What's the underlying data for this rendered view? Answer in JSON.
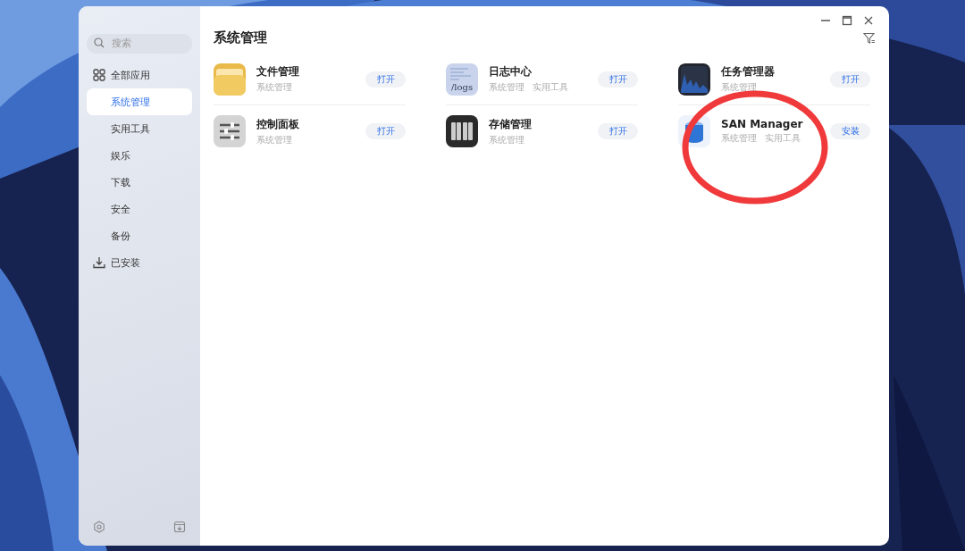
{
  "sidebar": {
    "search": {
      "placeholder": "搜索"
    },
    "items": [
      {
        "label": "全部应用",
        "kind": "group",
        "selected": false
      },
      {
        "label": "系统管理",
        "kind": "sub",
        "selected": true
      },
      {
        "label": "实用工具",
        "kind": "sub",
        "selected": false
      },
      {
        "label": "娱乐",
        "kind": "sub",
        "selected": false
      },
      {
        "label": "下载",
        "kind": "sub",
        "selected": false
      },
      {
        "label": "安全",
        "kind": "sub",
        "selected": false
      },
      {
        "label": "备份",
        "kind": "sub",
        "selected": false
      },
      {
        "label": "已安装",
        "kind": "group",
        "selected": false
      }
    ]
  },
  "main": {
    "title": "系统管理",
    "apps": [
      {
        "name": "文件管理",
        "tags": [
          "系统管理"
        ],
        "action": "打开"
      },
      {
        "name": "日志中心",
        "icon_text": "/logs",
        "tags": [
          "系统管理",
          "实用工具"
        ],
        "action": "打开"
      },
      {
        "name": "任务管理器",
        "tags": [
          "系统管理"
        ],
        "action": "打开"
      },
      {
        "name": "控制面板",
        "tags": [
          "系统管理"
        ],
        "action": "打开"
      },
      {
        "name": "存储管理",
        "tags": [
          "系统管理"
        ],
        "action": "打开"
      },
      {
        "name": "SAN Manager",
        "tags": [
          "系统管理",
          "实用工具"
        ],
        "action": "安装"
      }
    ]
  },
  "annotation": {
    "kind": "circle"
  }
}
